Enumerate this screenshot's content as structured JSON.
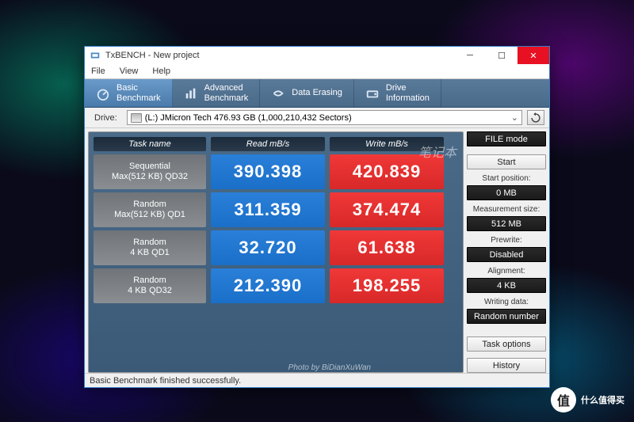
{
  "titlebar": {
    "title": "TxBENCH - New project"
  },
  "menu": {
    "file": "File",
    "view": "View",
    "help": "Help"
  },
  "tabs": [
    {
      "line1": "Basic",
      "line2": "Benchmark"
    },
    {
      "line1": "Advanced",
      "line2": "Benchmark"
    },
    {
      "line1": "Data Erasing",
      "line2": ""
    },
    {
      "line1": "Drive",
      "line2": "Information"
    }
  ],
  "drive": {
    "label": "Drive:",
    "selected": "(L:) JMicron Tech  476.93 GB (1,000,210,432 Sectors)"
  },
  "headers": {
    "task": "Task name",
    "read": "Read mB/s",
    "write": "Write mB/s"
  },
  "rows": [
    {
      "t1": "Sequential",
      "t2": "Max(512 KB) QD32",
      "read": "390.398",
      "write": "420.839"
    },
    {
      "t1": "Random",
      "t2": "Max(512 KB) QD1",
      "read": "311.359",
      "write": "374.474"
    },
    {
      "t1": "Random",
      "t2": "4 KB QD1",
      "read": "32.720",
      "write": "61.638"
    },
    {
      "t1": "Random",
      "t2": "4 KB QD32",
      "read": "212.390",
      "write": "198.255"
    }
  ],
  "side": {
    "file_mode": "FILE mode",
    "start": "Start",
    "start_pos_lbl": "Start position:",
    "start_pos": "0 MB",
    "meas_size_lbl": "Measurement size:",
    "meas_size": "512 MB",
    "prewrite_lbl": "Prewrite:",
    "prewrite": "Disabled",
    "align_lbl": "Alignment:",
    "align": "4 KB",
    "wdata_lbl": "Writing data:",
    "wdata": "Random number",
    "task_opts": "Task options",
    "history": "History"
  },
  "status": "Basic Benchmark finished successfully.",
  "watermark": "笔记本",
  "photo_by": "Photo by BiDianXuWan",
  "badge": {
    "char": "值",
    "text": "什么值得买"
  }
}
